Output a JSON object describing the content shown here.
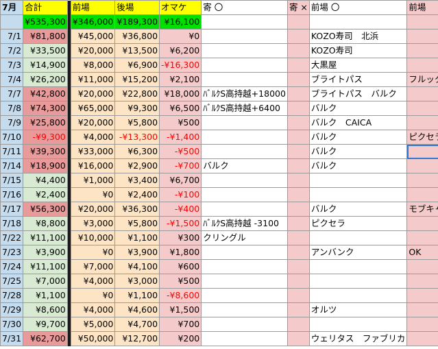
{
  "header": {
    "month": "7月",
    "total": "合計",
    "zenba": "前場",
    "goba": "後場",
    "omake": "オマケ",
    "grand_total": "¥535,300",
    "zenba_total": "¥346,000",
    "goba_total": "¥189,300",
    "omake_total": "¥16,100",
    "yori_maru": "寄 〇",
    "yori_batsu": "寄 ×",
    "zenba_maru": "前場 〇",
    "zenba_batsu": "前場"
  },
  "colors": {
    "yellow": "#ffff00",
    "green_header": "#00e000",
    "date_blue": "#c5dcef",
    "pos_green": "#d8ead2",
    "neg_red": "#e99a9a",
    "orange": "#fce4c4",
    "pink": "#f4caca",
    "dark_gap": "#1a1a1a"
  },
  "rows": [
    {
      "date": "7/1",
      "total": "¥81,800",
      "total_sign": "pos_strong",
      "zenba": "¥45,000",
      "goba": "¥36,800",
      "omake": "¥0",
      "yori_maru": "",
      "zenba_maru": "KOZO寿司　北浜",
      "zenba_batsu": ""
    },
    {
      "date": "7/2",
      "total": "¥33,500",
      "total_sign": "pos",
      "zenba": "¥20,000",
      "goba": "¥13,500",
      "omake": "¥6,200",
      "yori_maru": "",
      "zenba_maru": "KOZO寿司",
      "zenba_batsu": ""
    },
    {
      "date": "7/3",
      "total": "¥14,900",
      "total_sign": "pos",
      "zenba": "¥8,000",
      "goba": "¥6,900",
      "omake": "-¥16,300",
      "yori_maru": "",
      "zenba_maru": "大黒屋",
      "zenba_batsu": ""
    },
    {
      "date": "7/4",
      "total": "¥26,200",
      "total_sign": "pos",
      "zenba": "¥11,000",
      "goba": "¥15,200",
      "omake": "¥2,100",
      "yori_maru": "",
      "zenba_maru": "ブライトパス",
      "zenba_batsu": "フルッタ"
    },
    {
      "date": "7/7",
      "total": "¥42,800",
      "total_sign": "pos_strong",
      "zenba": "¥20,000",
      "goba": "¥22,800",
      "omake": "¥18,000",
      "yori_maru": "ﾊﾞﾙｸS高持越+18000",
      "zenba_maru": "ブライトパス　バルク",
      "zenba_batsu": ""
    },
    {
      "date": "7/8",
      "total": "¥74,300",
      "total_sign": "pos_strong",
      "zenba": "¥65,000",
      "goba": "¥9,300",
      "omake": "¥6,500",
      "yori_maru": "ﾊﾞﾙｸS高持越+6400",
      "zenba_maru": "バルク",
      "zenba_batsu": ""
    },
    {
      "date": "7/9",
      "total": "¥25,800",
      "total_sign": "pos_strong",
      "zenba": "¥20,000",
      "goba": "¥5,800",
      "omake": "¥500",
      "yori_maru": "",
      "zenba_maru": "バルク　CAICA",
      "zenba_batsu": ""
    },
    {
      "date": "7/10",
      "total": "-¥9,300",
      "total_sign": "neg",
      "zenba": "¥4,000",
      "goba": "-¥13,300",
      "omake": "-¥1,400",
      "yori_maru": "",
      "zenba_maru": "バルク",
      "zenba_batsu": "ピクセラ"
    },
    {
      "date": "7/11",
      "total": "¥39,300",
      "total_sign": "pos_strong",
      "zenba": "¥33,000",
      "goba": "¥6,300",
      "omake": "-¥500",
      "yori_maru": "",
      "zenba_maru": "バルク",
      "zenba_batsu": ""
    },
    {
      "date": "7/14",
      "total": "¥18,900",
      "total_sign": "pos_strong",
      "zenba": "¥16,000",
      "goba": "¥2,900",
      "omake": "-¥700",
      "yori_maru": "バルク",
      "zenba_maru": "バルク",
      "zenba_batsu": ""
    },
    {
      "date": "7/15",
      "total": "¥4,400",
      "total_sign": "pos",
      "zenba": "¥1,000",
      "goba": "¥3,400",
      "omake": "¥6,700",
      "yori_maru": "",
      "zenba_maru": "",
      "zenba_batsu": ""
    },
    {
      "date": "7/16",
      "total": "¥2,400",
      "total_sign": "pos",
      "zenba": "¥0",
      "goba": "¥2,400",
      "omake": "-¥100",
      "yori_maru": "",
      "zenba_maru": "",
      "zenba_batsu": ""
    },
    {
      "date": "7/17",
      "total": "¥56,300",
      "total_sign": "pos_strong",
      "zenba": "¥20,000",
      "goba": "¥36,300",
      "omake": "-¥400",
      "yori_maru": "",
      "zenba_maru": "バルク",
      "zenba_batsu": "モブキャス"
    },
    {
      "date": "7/18",
      "total": "¥8,800",
      "total_sign": "pos",
      "zenba": "¥3,000",
      "goba": "¥5,800",
      "omake": "-¥1,500",
      "yori_maru": "ﾊﾞﾙｸS高持越 -3100",
      "zenba_maru": "ピクセラ",
      "zenba_batsu": ""
    },
    {
      "date": "7/22",
      "total": "¥11,100",
      "total_sign": "pos",
      "zenba": "¥10,000",
      "goba": "¥1,100",
      "omake": "¥300",
      "yori_maru": "クリングル",
      "zenba_maru": "",
      "zenba_batsu": ""
    },
    {
      "date": "7/23",
      "total": "¥3,900",
      "total_sign": "pos",
      "zenba": "¥0",
      "goba": "¥3,900",
      "omake": "¥1,800",
      "yori_maru": "",
      "zenba_maru": "アンバンク",
      "zenba_batsu": "OK"
    },
    {
      "date": "7/24",
      "total": "¥11,100",
      "total_sign": "pos",
      "zenba": "¥7,000",
      "goba": "¥4,100",
      "omake": "¥600",
      "yori_maru": "",
      "zenba_maru": "",
      "zenba_batsu": ""
    },
    {
      "date": "7/25",
      "total": "¥7,000",
      "total_sign": "pos",
      "zenba": "¥4,000",
      "goba": "¥3,000",
      "omake": "¥500",
      "yori_maru": "",
      "zenba_maru": "",
      "zenba_batsu": ""
    },
    {
      "date": "7/28",
      "total": "¥1,100",
      "total_sign": "pos",
      "zenba": "¥0",
      "goba": "¥1,100",
      "omake": "-¥8,600",
      "yori_maru": "",
      "zenba_maru": "",
      "zenba_batsu": ""
    },
    {
      "date": "7/29",
      "total": "¥8,600",
      "total_sign": "pos",
      "zenba": "¥4,000",
      "goba": "¥4,600",
      "omake": "¥1,500",
      "yori_maru": "",
      "zenba_maru": "オルツ",
      "zenba_batsu": ""
    },
    {
      "date": "7/30",
      "total": "¥9,700",
      "total_sign": "pos",
      "zenba": "¥5,000",
      "goba": "¥4,700",
      "omake": "¥700",
      "yori_maru": "",
      "zenba_maru": "",
      "zenba_batsu": ""
    },
    {
      "date": "7/31",
      "total": "¥62,700",
      "total_sign": "pos_strong",
      "zenba": "¥50,000",
      "goba": "¥12,700",
      "omake": "¥200",
      "yori_maru": "",
      "zenba_maru": "ウェリタス　ファブリカ",
      "zenba_batsu": ""
    }
  ]
}
